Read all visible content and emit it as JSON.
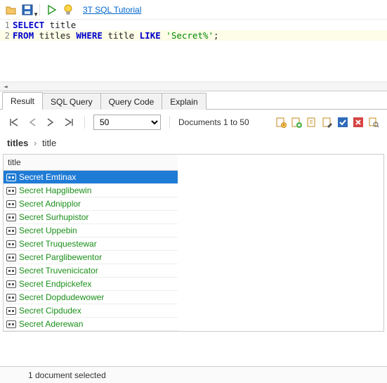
{
  "toolbar": {
    "tutorial_link": "3T SQL Tutorial"
  },
  "editor": {
    "lines": [
      {
        "n": "1",
        "html": "<span class='kw'>SELECT</span> title"
      },
      {
        "n": "2",
        "html": "<span class='kw'>FROM</span> titles <span class='kw'>WHERE</span> title <span class='kw'>LIKE</span> <span class='str'>'Secret%'</span>;"
      }
    ]
  },
  "tabs": [
    "Result",
    "SQL Query",
    "Query Code",
    "Explain"
  ],
  "active_tab": 0,
  "nav": {
    "page_size": "50",
    "doc_label": "Documents 1 to 50"
  },
  "breadcrumb": {
    "root": "titles",
    "leaf": "title"
  },
  "grid": {
    "header": "title",
    "rows": [
      "Secret Emtinax",
      "Secret Hapglibewin",
      "Secret Adnipplor",
      "Secret Surhupistor",
      "Secret Uppebin",
      "Secret Truquestewar",
      "Secret Parglibewentor",
      "Secret Truvenicicator",
      "Secret Endpickefex",
      "Secret Dopdudewower",
      "Secret Cipdudex",
      "Secret Aderewan"
    ],
    "selected_index": 0
  },
  "status": "1 document selected"
}
